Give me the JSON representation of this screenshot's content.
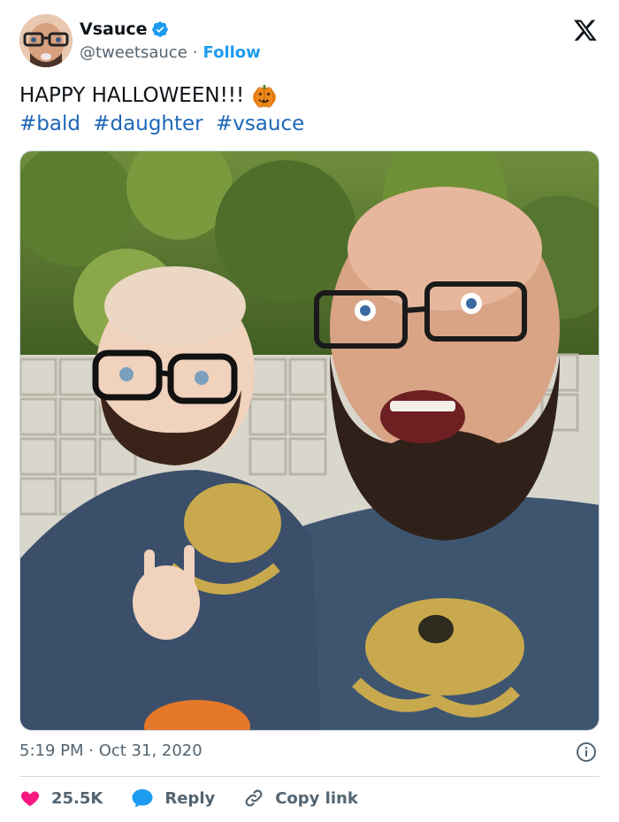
{
  "author": {
    "display_name": "Vsauce",
    "handle": "@tweetsauce",
    "separator": "·",
    "follow_label": "Follow",
    "verified": true,
    "verified_color": "#1d9bf0"
  },
  "tweet": {
    "text": "HAPPY HALLOWEEN!!!",
    "emoji": "pumpkin-emoji",
    "hashtags": [
      "#bald",
      "#daughter",
      "#vsauce"
    ],
    "hashtag_color": "#1d67b8"
  },
  "photo": {
    "description_icon": "photo"
  },
  "meta": {
    "timestamp": "5:19 PM · Oct 31, 2020"
  },
  "actions": {
    "likes": "25.5K",
    "reply_label": "Reply",
    "copy_link_label": "Copy link",
    "like_color": "#f91880",
    "reply_color": "#1d9bf0"
  }
}
